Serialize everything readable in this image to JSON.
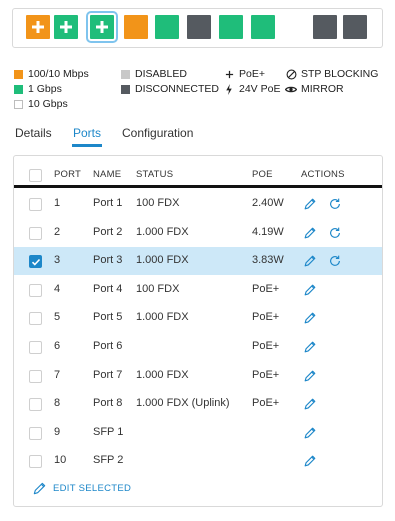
{
  "port_bar": {
    "ports": [
      {
        "id": "port-1",
        "color": "#f29419",
        "icon": "plus-icon",
        "selected": false
      },
      {
        "id": "port-2",
        "color": "#1fbd7a",
        "icon": "plus-icon",
        "selected": false
      },
      {
        "id": "port-3",
        "color": "#1fbd7a",
        "icon": "plus-icon",
        "selected": true
      },
      {
        "id": "port-4",
        "color": "#f29419",
        "icon": "",
        "selected": false
      },
      {
        "id": "port-5",
        "color": "#1fbd7a",
        "icon": "",
        "selected": false
      },
      {
        "id": "port-6",
        "color": "#555a60",
        "icon": "",
        "selected": false
      },
      {
        "id": "port-7",
        "color": "#1fbd7a",
        "icon": "",
        "selected": false
      },
      {
        "id": "port-8",
        "color": "#1fbd7a",
        "icon": "",
        "selected": false
      },
      {
        "id": "sfp-1",
        "color": "#555a60",
        "icon": "",
        "selected": false
      },
      {
        "id": "sfp-2",
        "color": "#555a60",
        "icon": "",
        "selected": false
      }
    ]
  },
  "legend": {
    "speed_100": "100/10 Mbps",
    "speed_1g": "1 Gbps",
    "speed_10g": "10 Gbps",
    "disabled": "DISABLED",
    "disconnected": "DISCONNECTED",
    "poe_plus": "PoE+",
    "poe_24v": "24V PoE",
    "stp_blocking": "STP BLOCKING",
    "mirror": "MIRROR",
    "colors": {
      "speed_100": "#f29419",
      "speed_1g": "#1fbd7a",
      "speed_10g": "#ffffff",
      "disabled": "#c8c8c8",
      "disconnected": "#555a60"
    }
  },
  "tabs": [
    {
      "label": "Details",
      "active": false
    },
    {
      "label": "Ports",
      "active": true
    },
    {
      "label": "Configuration",
      "active": false
    }
  ],
  "table": {
    "headers": {
      "port": "PORT",
      "name": "NAME",
      "status": "STATUS",
      "poe": "POE",
      "actions": "ACTIONS"
    },
    "rows": [
      {
        "port": "1",
        "name": "Port 1",
        "status": "100 FDX",
        "poe": "2.40W",
        "checked": false,
        "refresh": true
      },
      {
        "port": "2",
        "name": "Port 2",
        "status": "1.000 FDX",
        "poe": "4.19W",
        "checked": false,
        "refresh": true
      },
      {
        "port": "3",
        "name": "Port 3",
        "status": "1.000 FDX",
        "poe": "3.83W",
        "checked": true,
        "refresh": true
      },
      {
        "port": "4",
        "name": "Port 4",
        "status": "100 FDX",
        "poe": "PoE+",
        "checked": false,
        "refresh": false
      },
      {
        "port": "5",
        "name": "Port 5",
        "status": "1.000 FDX",
        "poe": "PoE+",
        "checked": false,
        "refresh": false
      },
      {
        "port": "6",
        "name": "Port 6",
        "status": "",
        "poe": "PoE+",
        "checked": false,
        "refresh": false
      },
      {
        "port": "7",
        "name": "Port 7",
        "status": "1.000 FDX",
        "poe": "PoE+",
        "checked": false,
        "refresh": false
      },
      {
        "port": "8",
        "name": "Port 8",
        "status": "1.000 FDX (Uplink)",
        "poe": "PoE+",
        "checked": false,
        "refresh": false
      },
      {
        "port": "9",
        "name": "SFP 1",
        "status": "",
        "poe": "",
        "checked": false,
        "refresh": false
      },
      {
        "port": "10",
        "name": "SFP 2",
        "status": "",
        "poe": "",
        "checked": false,
        "refresh": false
      }
    ],
    "edit_selected_label": "EDIT SELECTED"
  },
  "accent_color": "#1d87c9"
}
